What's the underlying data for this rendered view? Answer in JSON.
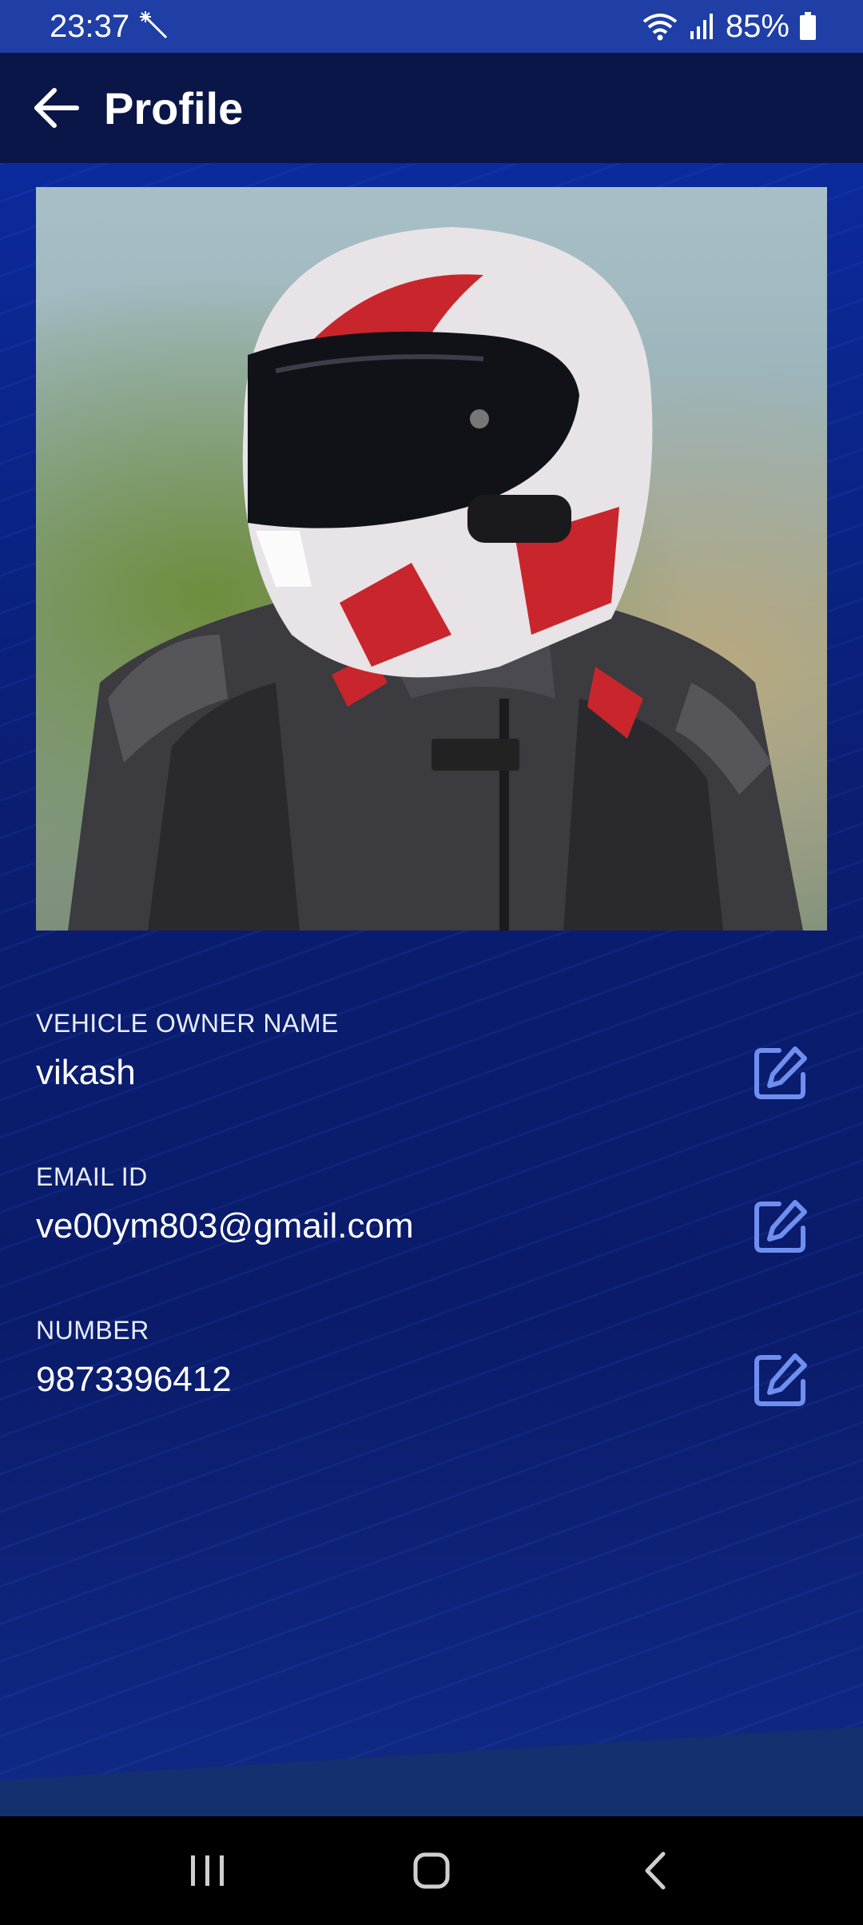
{
  "status_bar": {
    "time": "23:37",
    "battery": "85%"
  },
  "app_bar": {
    "title": "Profile"
  },
  "profile": {
    "photo_alt": "Profile photo"
  },
  "fields": [
    {
      "label": "VEHICLE OWNER NAME",
      "value": "vikash"
    },
    {
      "label": "EMAIL ID",
      "value": "ve00ym803@gmail.com"
    },
    {
      "label": "NUMBER",
      "value": "9873396412"
    }
  ],
  "colors": {
    "status_bar": "#1f3fa6",
    "app_bar": "#0a1648",
    "edit_icon": "#6f8ff0"
  },
  "icons": {
    "back": "arrow-left-icon",
    "edit": "pencil-square-icon",
    "recent_apps": "recents-icon",
    "home": "home-icon",
    "nav_back": "chevron-left-icon"
  }
}
